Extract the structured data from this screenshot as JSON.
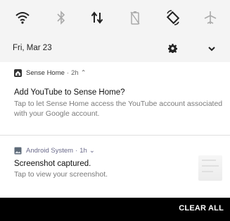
{
  "quick_settings": {
    "tiles": [
      {
        "icon": "wifi-icon",
        "state": "on"
      },
      {
        "icon": "bluetooth-icon",
        "state": "off"
      },
      {
        "icon": "data-transfer-icon",
        "state": "on"
      },
      {
        "icon": "battery-saver-icon",
        "state": "off"
      },
      {
        "icon": "rotate-icon",
        "state": "on"
      },
      {
        "icon": "airplane-icon",
        "state": "off"
      }
    ],
    "date": "Fri, Mar 23"
  },
  "notifications": [
    {
      "app": "Sense Home",
      "time": "2h",
      "title": "Add YouTube to Sense Home?",
      "body": "Tap to let Sense Home access the YouTube account associated with your Google account."
    },
    {
      "app": "Android System",
      "time": "1h",
      "title": "Screenshot captured.",
      "body": "Tap to view your screenshot."
    }
  ],
  "footer": {
    "clear_all": "CLEAR ALL"
  },
  "colors": {
    "panel": "#f4f4f4",
    "card": "#ffffff",
    "footer": "#000000",
    "secondary_text": "#7a7a7a"
  }
}
